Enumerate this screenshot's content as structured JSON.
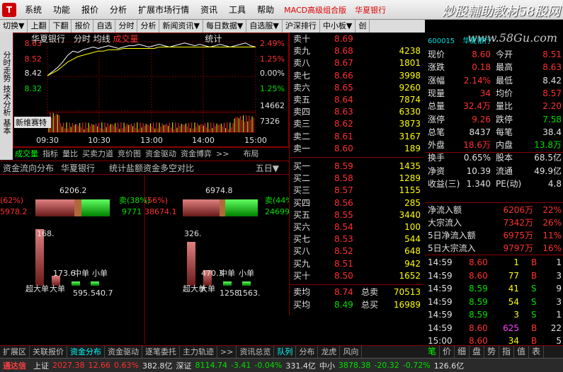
{
  "app": {
    "logo": "T",
    "menus": [
      "系统",
      "功能",
      "报价",
      "分析",
      "扩展市场行情",
      "资讯",
      "工具",
      "帮助"
    ],
    "red_menus": [
      "MACD高级组合版",
      "华夏银行"
    ],
    "watermark": "炒股輔助教材58股网",
    "watermark_url": "www.58Gu.com"
  },
  "toolbar": [
    "切换▼",
    "上翻",
    "下翻",
    "报价",
    "自选",
    "分时",
    "分析",
    "新闻资讯▼",
    "每日数据▼",
    "自选服▼",
    "沪深排行",
    "中小板▼",
    "创"
  ],
  "side_tabs": [
    "分时走势",
    "技术分析",
    "基本"
  ],
  "chart": {
    "stock": "华夏银行",
    "mode": "分时",
    "ma": "均线",
    "vol": "成交量",
    "stat": "统计",
    "left_prices": [
      "8.63",
      "8.52",
      "8.42",
      "8.32"
    ],
    "right_pcts": [
      "2.49%",
      "1.25%",
      "0.00%",
      "1.25%"
    ],
    "vol_labels": [
      "14662",
      "7326"
    ],
    "times": [
      "09:30",
      "10:30",
      "13:00",
      "14:00",
      "15:00"
    ],
    "tooltip": "新维赛特",
    "pct_series": [
      0.0,
      0.3,
      0.6,
      1.0,
      1.5,
      1.8,
      1.7,
      1.9,
      2.0,
      2.1,
      2.0,
      2.1,
      2.2,
      2.1,
      2.0,
      2.1,
      2.2,
      2.2,
      2.3,
      2.2,
      2.1,
      2.2,
      2.3,
      2.2,
      2.1,
      2.2,
      2.3,
      2.4,
      2.3,
      2.2,
      2.3,
      2.2,
      2.1,
      2.2,
      2.3,
      2.2,
      2.1,
      2.2,
      2.3,
      2.4,
      2.2,
      2.1
    ],
    "avg_series": [
      0.0,
      0.2,
      0.4,
      0.7,
      1.0,
      1.2,
      1.4,
      1.5,
      1.6,
      1.7,
      1.8,
      1.8,
      1.9,
      1.9,
      1.9,
      2.0,
      2.0,
      2.0,
      2.0,
      2.0,
      2.0,
      2.0,
      2.1,
      2.1,
      2.1,
      2.1,
      2.1,
      2.1,
      2.1,
      2.1,
      2.1,
      2.1,
      2.1,
      2.1,
      2.1,
      2.1,
      2.1,
      2.1,
      2.1,
      2.1,
      2.1,
      2.1
    ]
  },
  "left_tabs": [
    "成交量",
    "指标",
    "量比",
    "买卖力道",
    "竞价图",
    "资金驱动",
    "资金博弈"
  ],
  "layout_btn": "布局",
  "more": ">>",
  "flow": {
    "title": "资金流向分布",
    "stock": "华夏银行",
    "stat": "统计盐额",
    "duikong": "资金多空对比",
    "period": "五日▼",
    "left": {
      "top": "6206.2",
      "buy_pct": "(62%)",
      "sell": "卖(38%)",
      "total_l": "5978.2",
      "total_r": "9771",
      "bars": [
        "168.",
        "173.6",
        "595.",
        "540.7"
      ],
      "labels": [
        "超大单",
        "大单",
        "中单",
        "小单"
      ]
    },
    "right": {
      "top": "6974.8",
      "sell": "卖(44%)",
      "buy_pct": "(56%)",
      "total_l": "38674.1",
      "total_r": "24699",
      "bars": [
        "326.",
        "470.3",
        "1258",
        "1563."
      ],
      "labels": [
        "超大单",
        "大单",
        "中单",
        "小单"
      ]
    }
  },
  "orderbook": {
    "sells": [
      [
        "卖十",
        "8.69",
        "",
        ""
      ],
      [
        "卖九",
        "8.68",
        "4238",
        ""
      ],
      [
        "卖八",
        "8.67",
        "1801",
        ""
      ],
      [
        "卖七",
        "8.66",
        "3998",
        ""
      ],
      [
        "卖六",
        "8.65",
        "9260",
        ""
      ],
      [
        "卖五",
        "8.64",
        "7874",
        ""
      ],
      [
        "卖四",
        "8.63",
        "6330",
        ""
      ],
      [
        "卖三",
        "8.62",
        "3873",
        ""
      ],
      [
        "卖二",
        "8.61",
        "3167",
        ""
      ],
      [
        "卖一",
        "8.60",
        "189",
        ""
      ]
    ],
    "buys": [
      [
        "买一",
        "8.59",
        "1435",
        ""
      ],
      [
        "买二",
        "8.58",
        "1289",
        ""
      ],
      [
        "买三",
        "8.57",
        "1155",
        ""
      ],
      [
        "买四",
        "8.56",
        "285",
        ""
      ],
      [
        "买五",
        "8.55",
        "3440",
        ""
      ],
      [
        "买六",
        "8.54",
        "100",
        ""
      ],
      [
        "买七",
        "8.53",
        "544",
        ""
      ],
      [
        "买八",
        "8.52",
        "648",
        ""
      ],
      [
        "买九",
        "8.51",
        "942",
        ""
      ],
      [
        "买十",
        "8.50",
        "1652",
        ""
      ]
    ],
    "avg_sell_l": "卖均",
    "avg_sell": "8.74",
    "total_sell_l": "总卖",
    "total_sell": "70513",
    "avg_buy_l": "买均",
    "avg_buy": "8.49",
    "total_buy_l": "总买",
    "total_buy": "16989"
  },
  "quote": {
    "code": "600015",
    "name": "华夏银行",
    "rows": [
      [
        "现价",
        "8.60",
        "今开",
        "8.51"
      ],
      [
        "涨跌",
        "0.18",
        "最高",
        "8.63"
      ],
      [
        "涨幅",
        "2.14%",
        "最低",
        "8.42"
      ],
      [
        "现量",
        "34",
        "均价",
        "8.57"
      ],
      [
        "总量",
        "32.4万",
        "量比",
        "2.20"
      ],
      [
        "涨停",
        "9.26",
        "跌停",
        "7.58"
      ],
      [
        "总笔",
        "8437",
        "每笔",
        "38.4"
      ],
      [
        "外盘",
        "18.6万",
        "内盘",
        "13.8万"
      ],
      [
        "换手",
        "0.65%",
        "股本",
        "68.5亿"
      ],
      [
        "净资",
        "10.39",
        "流通",
        "49.9亿"
      ],
      [
        "收益(三)",
        "1.340",
        "PE(动)",
        "4.8"
      ]
    ],
    "flows": [
      [
        "净流入额",
        "6206万",
        "22%"
      ],
      [
        "大宗流入",
        "7342万",
        "26%"
      ],
      [
        "5日净流入额",
        "6975万",
        "11%"
      ],
      [
        "5日大宗流入",
        "9797万",
        "16%"
      ]
    ],
    "ticks": [
      [
        "14:59",
        "8.60",
        "1",
        "B",
        "1"
      ],
      [
        "14:59",
        "8.60",
        "77",
        "B",
        "3"
      ],
      [
        "14:59",
        "8.59",
        "41",
        "S",
        "9"
      ],
      [
        "14:59",
        "8.59",
        "54",
        "S",
        "3"
      ],
      [
        "14:59",
        "8.59",
        "3",
        "S",
        "1"
      ],
      [
        "14:59",
        "8.60",
        "625",
        "B",
        "22"
      ],
      [
        "15:00",
        "8.60",
        "34",
        "B",
        "5"
      ]
    ]
  },
  "bottom_tabs": [
    "扩展区",
    "关联报价",
    "资金分布",
    "资金驱动",
    "逐笔委托",
    "主力轨迹",
    ">>",
    "资讯总览",
    "队列",
    "分布",
    "龙虎",
    "风向"
  ],
  "right_tabs": [
    "笔",
    "价",
    "细",
    "盘",
    "势",
    "指",
    "值",
    "表"
  ],
  "status": {
    "brand": "通达信",
    "sh": "上证",
    "sh_val": "2027.38",
    "sh_chg": "12.66",
    "sh_pct": "0.63%",
    "sh_amt": "382.8亿",
    "sz": "深证",
    "sz_val": "8114.74",
    "sz_chg": "-3.41",
    "sz_pct": "-0.04%",
    "sz_amt": "331.4亿",
    "zx": "中小",
    "zx_val": "3878.38",
    "zx_chg": "-20.32",
    "zx_pct": "-0.72%",
    "zx_amt": "126.6亿"
  }
}
